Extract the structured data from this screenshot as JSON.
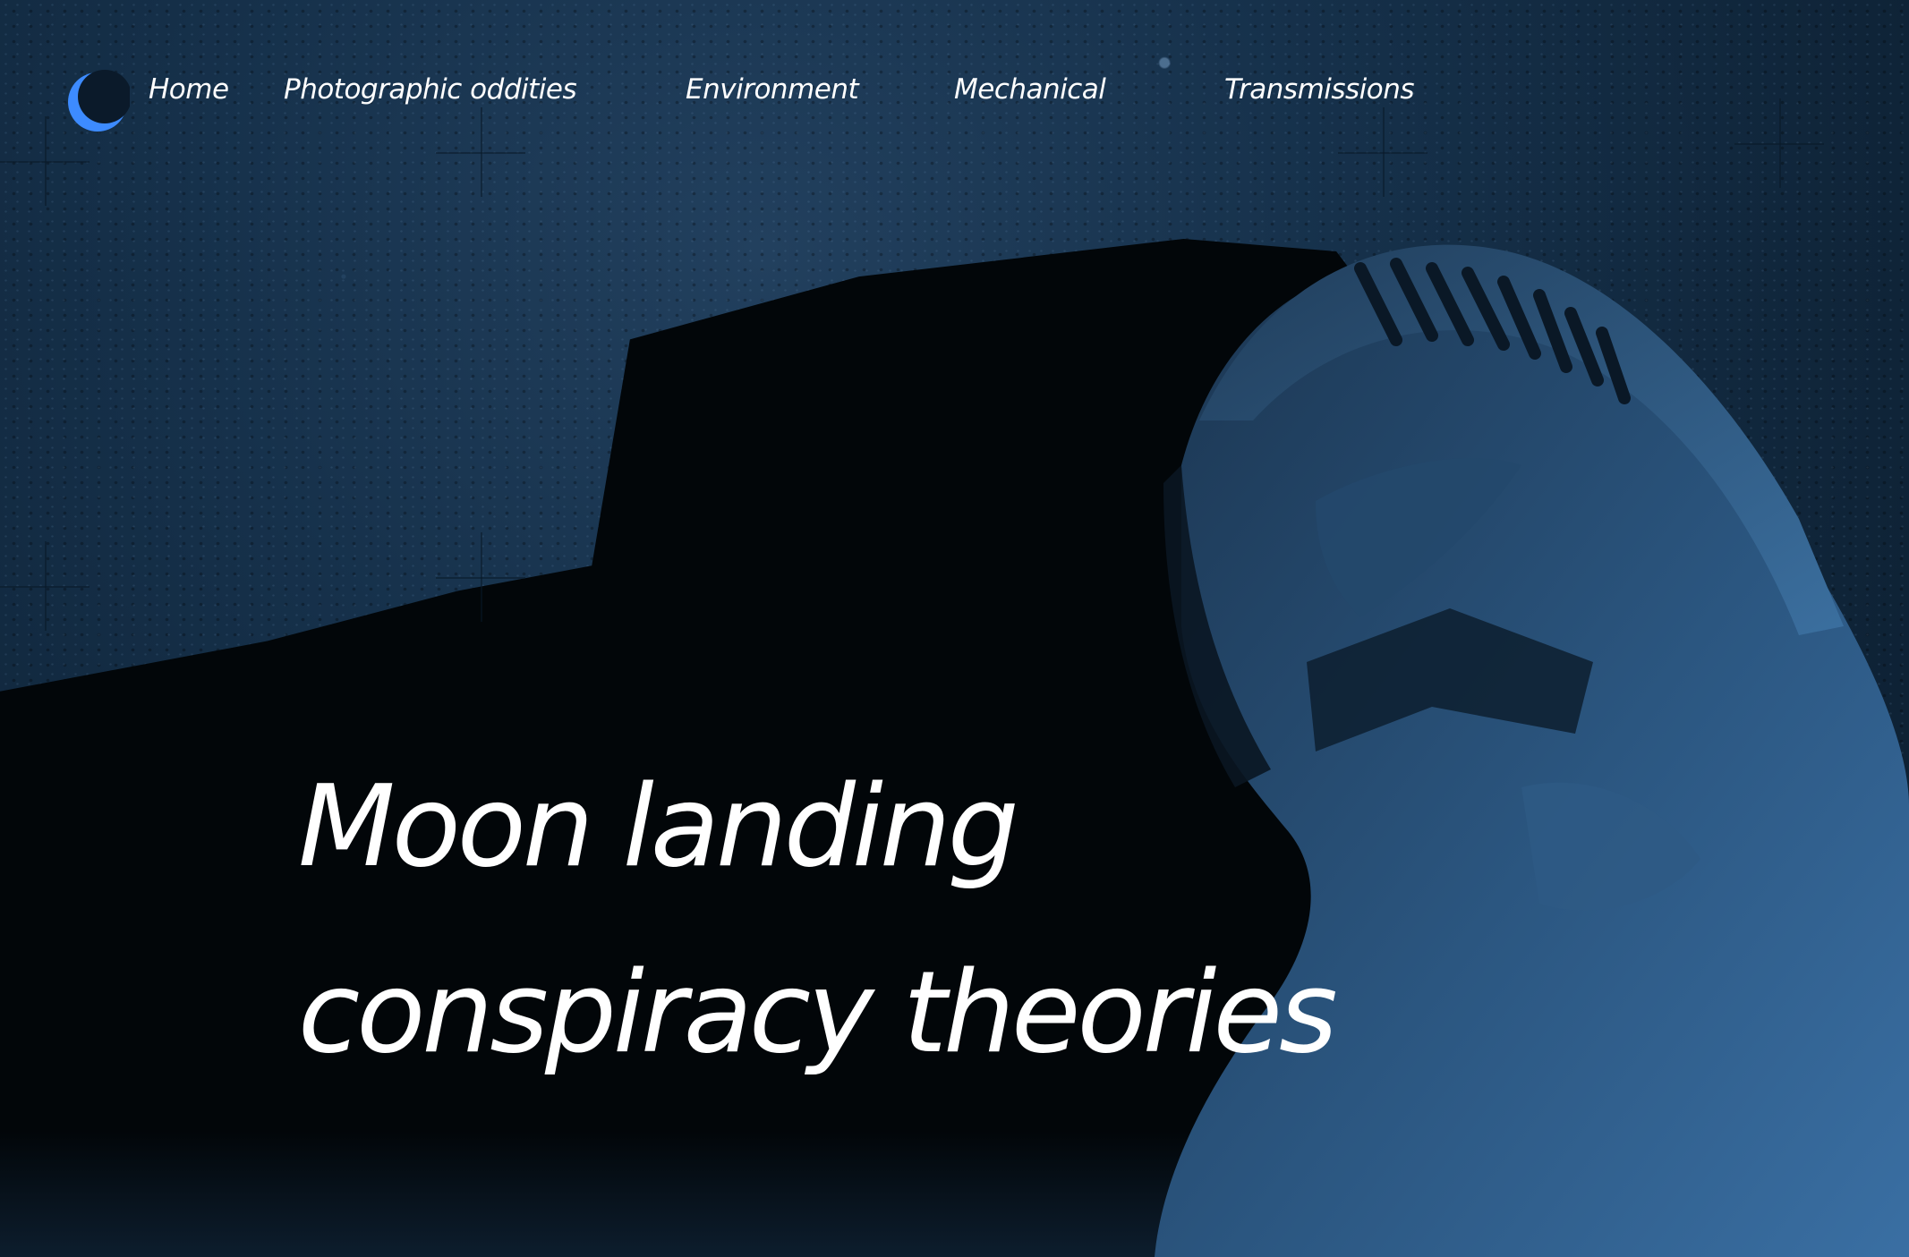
{
  "nav": {
    "items": [
      {
        "label": "Home"
      },
      {
        "label": "Photographic oddities"
      },
      {
        "label": "Environment"
      },
      {
        "label": "Mechanical"
      },
      {
        "label": "Transmissions"
      }
    ]
  },
  "hero": {
    "title_line_1": "Moon landing",
    "title_line_2": "conspiracy theories"
  },
  "colors": {
    "accent": "#3d8bff",
    "text": "#ffffff",
    "background_dark": "#020609",
    "background_blue": "#1e3d5c"
  },
  "icons": {
    "logo": "crescent-moon-icon"
  }
}
